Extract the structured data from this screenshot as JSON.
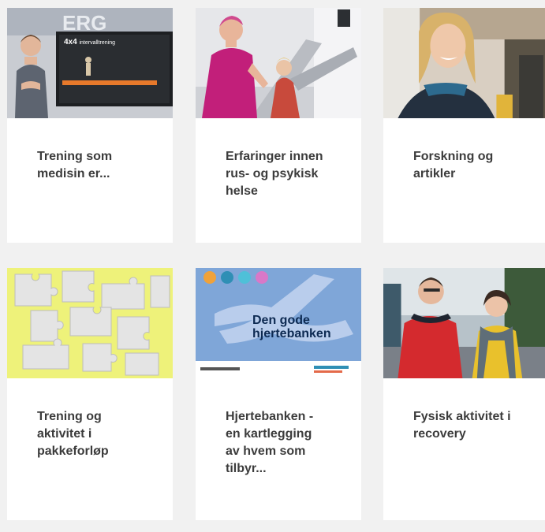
{
  "cards": [
    {
      "title_lines": [
        "Trening som",
        "medisin er..."
      ],
      "image": "presenter-with-screen-photo",
      "screen_heading": "4x4",
      "screen_sub": "intervalltrening"
    },
    {
      "title_lines": [
        "Erfaringer innen",
        "rus- og psykisk",
        "helse"
      ],
      "image": "gym-treadmill-photo"
    },
    {
      "title_lines": [
        "Forskning og",
        "artikler"
      ],
      "image": "smiling-woman-photo"
    },
    {
      "title_lines": [
        "Trening og",
        "aktivitet i",
        "pakkeforløp"
      ],
      "image": "puzzle-pieces-photo"
    },
    {
      "title_lines": [
        "Hjertebanken -",
        "en kartlegging",
        "av hvem som",
        "tilbyr..."
      ],
      "image": "poster-illustration",
      "poster_title_lines": [
        "Den gode",
        "hjertebanken"
      ]
    },
    {
      "title_lines": [
        "Fysisk aktivitet i",
        "recovery"
      ],
      "image": "two-people-outdoors-photo"
    }
  ],
  "colors": {
    "background": "#f1f1f1",
    "card": "#ffffff",
    "title_text": "#3c3c3c",
    "puzzle_yellow": "#eef27a",
    "poster_blue": "#7fa6d8"
  }
}
